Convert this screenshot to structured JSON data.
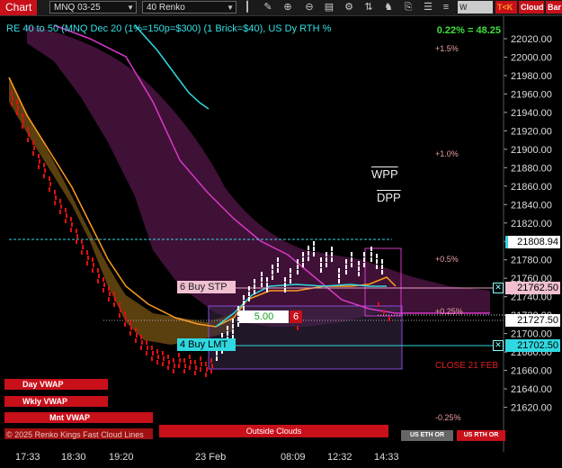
{
  "toolbar": {
    "chart_tab": "Chart",
    "instrument": "MNQ 03-25",
    "bar_type": "40 Renko",
    "icons": [
      "bar-style-icon",
      "drawing-tools-icon",
      "zoom-in-icon",
      "zoom-out-icon",
      "data-box-icon",
      "properties-icon",
      "indicators-icon",
      "strategies-icon",
      "templates-icon",
      "chart-trader-icon"
    ],
    "btn_wvwap": "W VWAP",
    "btn_tk": "T<K",
    "btn_cloud": "Cloud",
    "btn_bar": "Bar"
  },
  "chart": {
    "header": "RE 40 to 50 (MNQ Dec 20 (1%=150p=$300) (1 Brick=$40), US Dy RTH %",
    "change": "0.22% = 48.25",
    "wpp": "WPP",
    "dpp": "DPP",
    "close_label": "CLOSE 21 FEB",
    "footer_text": "© 2025 Renko Kings Fast Cloud Lines",
    "outside_clouds": "Outside Clouds",
    "btn_eth": "US ETH OR",
    "btn_rth": "US RTH OR"
  },
  "pct_labels": [
    "+1.5%",
    "+1.0%",
    "+0.5%",
    "+0.25%",
    "-0.25%"
  ],
  "vwap_pills": [
    "Day VWAP",
    "Wkly VWAP",
    "Mnt VWAP"
  ],
  "orders": {
    "stop_label": "6 Buy STP",
    "stop_price": "21762.50",
    "limit_label": "4 Buy LMT",
    "limit_price": "21702.50",
    "qty_value": "5.00",
    "qty_badge": "6"
  },
  "price_markers": {
    "cyan_line": "21808.94",
    "current": "21727.50"
  },
  "y_axis": {
    "min": 21600,
    "max": 22020,
    "ticks": [
      "22020.00",
      "22000.00",
      "21980.00",
      "21960.00",
      "21940.00",
      "21920.00",
      "21900.00",
      "21880.00",
      "21860.00",
      "21840.00",
      "21820.00",
      "21800.00",
      "21780.00",
      "21760.00",
      "21740.00",
      "21720.00",
      "21700.00",
      "21680.00",
      "21660.00",
      "21640.00",
      "21620.00"
    ]
  },
  "x_axis": [
    "17:33",
    "18:30",
    "19:20",
    "23 Feb",
    "08:09",
    "12:32",
    "14:33"
  ],
  "colors": {
    "bull_brick": "#ffffff",
    "bear_brick": "#e01010",
    "cloud_bear": "#6a4a12",
    "cloud_purple": "#5a1a4a",
    "magenta_line": "#d838c8",
    "orange_line": "#ff9a20",
    "cyan_line": "#30d8e0",
    "accent_red": "#c8101a"
  }
}
